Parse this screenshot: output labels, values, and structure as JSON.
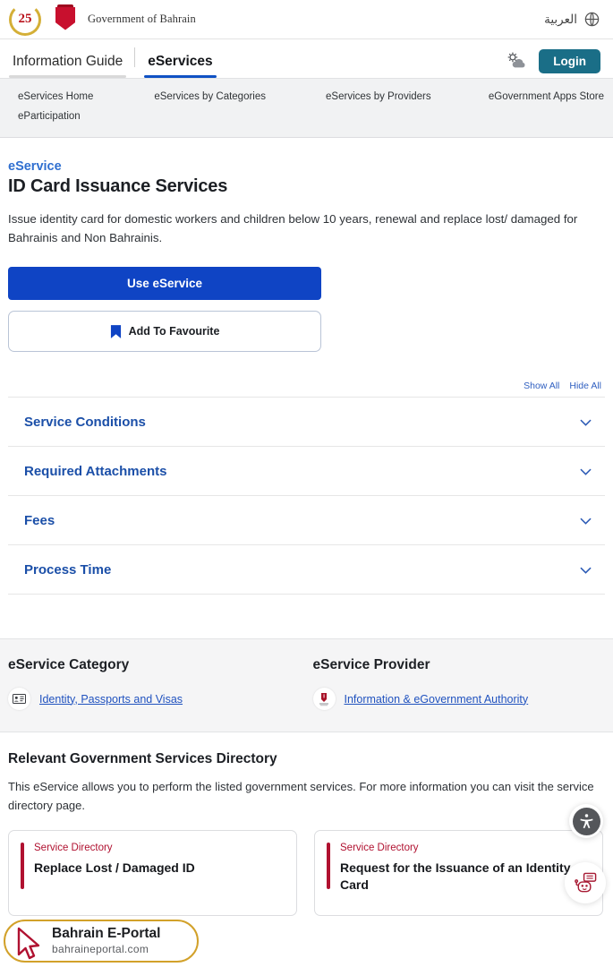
{
  "topbar": {
    "gov_name": "Government of Bahrain",
    "seal_number": "25",
    "lang_switch": "العربية",
    "globe_icon": "globe-icon"
  },
  "tabbar": {
    "tabs": [
      {
        "label": "Information Guide",
        "active": false
      },
      {
        "label": "eServices",
        "active": true
      }
    ],
    "weather_icon": "weather-sun-cloud-icon",
    "login_label": "Login",
    "login_color": "#1a6e87"
  },
  "subnav": {
    "items": [
      "eServices Home",
      "eServices by Categories",
      "eServices by Providers",
      "eGovernment Apps Store",
      "eParticipation"
    ]
  },
  "main": {
    "kicker": "eService",
    "title": "ID Card Issuance Services",
    "description": "Issue identity card for domestic workers and children below 10 years, renewal and replace lost/ damaged for Bahrainis and Non Bahrainis.",
    "primary_button": "Use eService",
    "favourite_button": "Add To Favourite",
    "favourite_icon": "bookmark-icon",
    "primary_color": "#0f44c4"
  },
  "accordion": {
    "show_all": "Show All",
    "hide_all": "Hide All",
    "items": [
      {
        "label": "Service Conditions"
      },
      {
        "label": "Required Attachments"
      },
      {
        "label": "Fees"
      },
      {
        "label": "Process Time"
      }
    ]
  },
  "meta": {
    "category_heading": "eService Category",
    "category_link": "Identity, Passports and Visas",
    "category_icon": "id-card-icon",
    "provider_heading": "eService Provider",
    "provider_link": "Information & eGovernment Authority",
    "provider_icon": "iga-crest-icon"
  },
  "directory": {
    "heading": "Relevant Government Services Directory",
    "description": "This eService allows you to perform the listed government services. For more information you can visit the service directory page.",
    "cards": [
      {
        "kicker": "Service Directory",
        "title": "Replace Lost / Damaged ID"
      },
      {
        "kicker": "Service Directory",
        "title": "Request for the Issuance of an Identity Card"
      }
    ],
    "accent_color": "#b01130"
  },
  "floating": {
    "accessibility_icon": "accessibility-icon",
    "chatbot_icon": "chatbot-robot-icon"
  },
  "watermark": {
    "title": "Bahrain E-Portal",
    "subtitle": "bahraineportal.com",
    "cursor_icon": "mouse-cursor-icon"
  }
}
